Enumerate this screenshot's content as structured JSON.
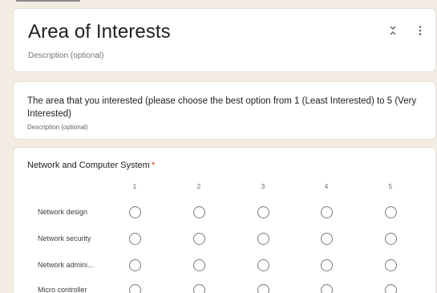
{
  "section": {
    "title": "Area of Interests",
    "description": "Description (optional)",
    "collapse_icon": "collapse-chevrons-icon",
    "more_icon": "more-vertical-icon"
  },
  "question_block": {
    "text": "The area that you interested (please choose the best option from 1 (Least Interested) to 5  (Very Interested)",
    "description": "Description (optional)"
  },
  "grid_question": {
    "title": "Network and Computer System",
    "required_mark": "*",
    "columns": [
      "1",
      "2",
      "3",
      "4",
      "5"
    ],
    "rows": [
      {
        "label": "Network design"
      },
      {
        "label": "Network security"
      },
      {
        "label": "Network admini..."
      },
      {
        "label": "Micro controller"
      }
    ]
  },
  "colors": {
    "background": "#f3ece2",
    "card": "#ffffff",
    "required": "#d93025",
    "radio_border": "#7a7a7a"
  }
}
